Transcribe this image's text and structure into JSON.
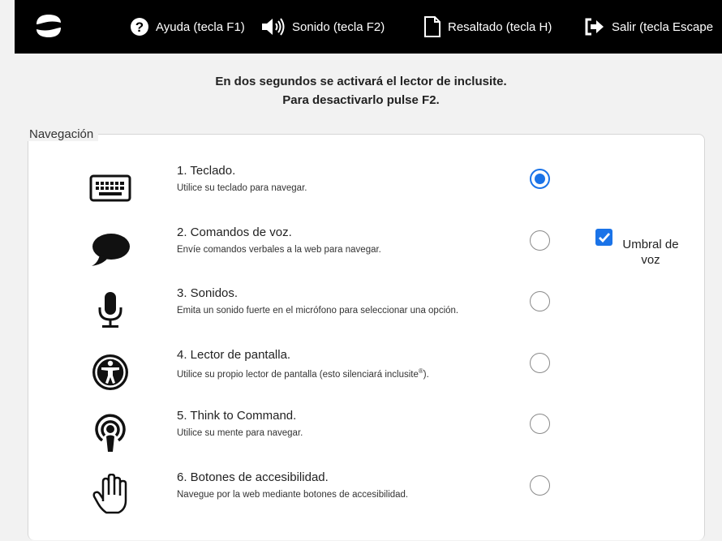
{
  "toolbar": {
    "logo_icon": "inclusite-logo-icon",
    "help_icon": "help-circle-icon",
    "help_label": "Ayuda (tecla F1)",
    "sound_icon": "speaker-icon",
    "sound_label": "Sonido (tecla F2)",
    "highlight_icon": "document-icon",
    "highlight_label": "Resaltado (tecla H)",
    "exit_icon": "exit-arrow-icon",
    "exit_label": "Salir (tecla Escape"
  },
  "message": {
    "line1": "En dos segundos se activará el lector de inclusite.",
    "line2": "Para desactivarlo pulse F2."
  },
  "navigation": {
    "legend": "Navegación",
    "options": [
      {
        "title": "1. Teclado.",
        "description": "Utilice su teclado para navegar.",
        "icon": "keyboard-icon",
        "selected": true
      },
      {
        "title": "2. Comandos de voz.",
        "description": "Envíe comandos verbales a la web para navegar.",
        "icon": "speech-bubble-icon",
        "selected": false
      },
      {
        "title": "3. Sonidos.",
        "description": "Emita un sonido fuerte en el micrófono para seleccionar una opción.",
        "icon": "microphone-icon",
        "selected": false
      },
      {
        "title": "4. Lector de pantalla.",
        "description": "Utilice su propio lector de pantalla (esto silenciará inclusite",
        "description_mark": "®",
        "description_end": ").",
        "icon": "accessibility-icon",
        "selected": false
      },
      {
        "title": "5. Think to Command.",
        "description": "Utilice su mente para navegar.",
        "icon": "podcast-icon",
        "selected": false
      },
      {
        "title": "6. Botones de accesibilidad.",
        "description": "Navegue por la web mediante botones de accesibilidad.",
        "icon": "hand-icon",
        "selected": false
      }
    ],
    "voice_threshold": {
      "label": "Umbral de voz",
      "checked": true
    }
  },
  "colors": {
    "toolbar_bg": "#000000",
    "accent": "#1a73e8",
    "page_bg": "#f2f2f2"
  }
}
